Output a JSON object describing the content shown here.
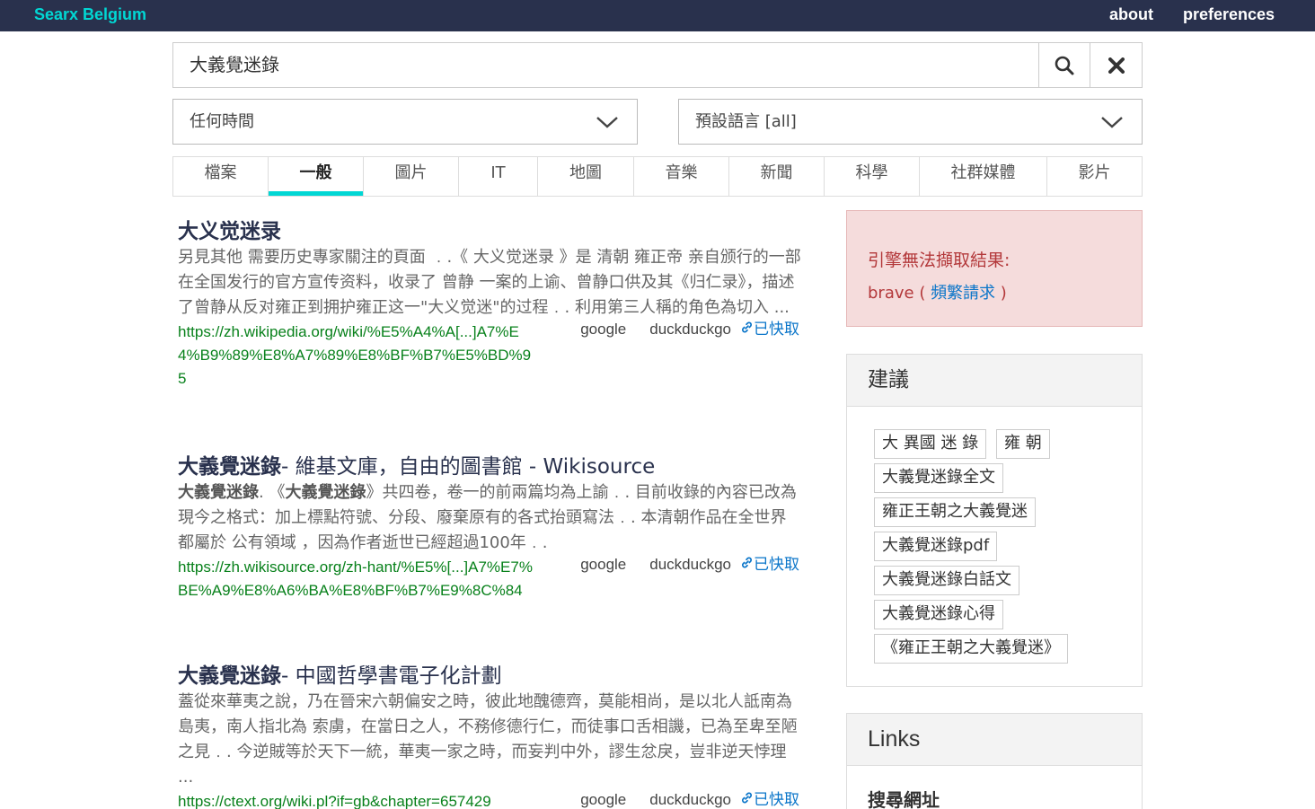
{
  "topbar": {
    "brand": "Searx Belgium",
    "about": "about",
    "preferences": "preferences"
  },
  "search": {
    "query": "大義覺迷錄",
    "search_icon": "search-icon",
    "clear_icon": "close-icon"
  },
  "filters": {
    "time_range": "任何時間",
    "language": "預設語言 [all]"
  },
  "tabs": [
    {
      "label": "檔案",
      "active": false
    },
    {
      "label": "一般",
      "active": true
    },
    {
      "label": "圖片",
      "active": false
    },
    {
      "label": "IT",
      "active": false
    },
    {
      "label": "地圖",
      "active": false
    },
    {
      "label": "音樂",
      "active": false
    },
    {
      "label": "新聞",
      "active": false
    },
    {
      "label": "科學",
      "active": false
    },
    {
      "label": "社群媒體",
      "active": false
    },
    {
      "label": "影片",
      "active": false
    }
  ],
  "results": [
    {
      "title_bold": "",
      "title_rest": "大义觉迷录",
      "content_bold": "",
      "content": "另見其他 需要历史專家關注的頁面 ﹒.《 大义觉迷录 》是 清朝 雍正帝 亲自颁行的一部在全国发行的官方宣传资料，收录了 曾静 一案的上谕、曾静口供及其《归仁录》，描述了曾静从反对雍正到拥护雍正这一\"大义觉迷\"的过程﹒. 利用第三人稱的角色為切入 ...",
      "url": "https://zh.wikipedia.org/wiki/%E5%A4%A[...]A7%E4%B9%89%E8%A7%89%E8%BF%B7%E5%BD%95",
      "engines": [
        "google",
        "duckduckgo"
      ],
      "cache_label": "已快取"
    },
    {
      "title_bold": "大義覺迷錄",
      "title_rest": "- 維基文庫，自由的圖書館 - Wikisource",
      "content_bold": "大義覺迷錄",
      "content_mid1": ". 《",
      "content_bold2": "大義覺迷錄",
      "content": "》共四卷，卷一的前兩篇均為上諭﹒. 目前收錄的內容已改為現今之格式：加上標點符號、分段、廢棄原有的各式抬頭寫法﹒. 本清朝作品在全世界都屬於 公有領域 ，因為作者逝世已經超過100年﹒.",
      "url": "https://zh.wikisource.org/zh-hant/%E5%[...]A7%E7%BE%A9%E8%A6%BA%E8%BF%B7%E9%8C%84",
      "engines": [
        "google",
        "duckduckgo"
      ],
      "cache_label": "已快取"
    },
    {
      "title_bold": "大義覺迷錄",
      "title_rest": "- 中國哲學書電子化計劃",
      "content_bold": "",
      "content": "蓋從來華夷之說，乃在晉宋六朝偏安之時，彼此地醜德齊，莫能相尚，是以北人詆南為島夷，南人指北為 索虜，在當日之人，不務修德行仁，而徒事口舌相譏，已為至卑至陋之見﹒. 今逆賊等於天下一統，華夷一家之時，而妄判中外，謬生忿戾，豈非逆天悖理 ...",
      "url": "https://ctext.org/wiki.pl?if=gb&chapter=657429",
      "engines": [
        "google",
        "duckduckgo"
      ],
      "cache_label": "已快取"
    }
  ],
  "error_box": {
    "title": "引擎無法擷取結果:",
    "engine": "brave",
    "open_paren": " ( ",
    "reason": "頻繁請求",
    "close_paren": " )"
  },
  "suggestions": {
    "heading": "建議",
    "items": [
      "大 異國 迷 錄",
      "雍 朝",
      "大義覺迷錄全文",
      "雍正王朝之大義覺迷",
      "大義覺迷錄pdf",
      "大義覺迷錄白話文",
      "大義覺迷錄心得",
      "《雍正王朝之大義覺迷》"
    ]
  },
  "links": {
    "heading": "Links",
    "search_url_label": "搜尋網址"
  },
  "colors": {
    "topbar": "#29314d",
    "brand": "#01d7d4",
    "active_tab_underline": "#01d7d4",
    "result_title": "#29314d",
    "url": "#08811b",
    "link": "#0a75c9",
    "error_bg": "#f5dcdc",
    "error_text": "#b3383a"
  }
}
